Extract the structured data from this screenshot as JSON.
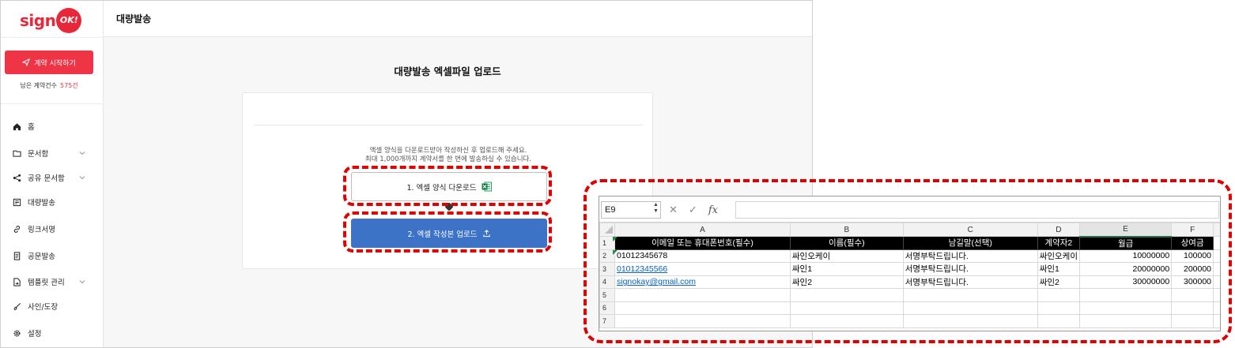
{
  "logo": {
    "text": "sign",
    "badge": "OK!"
  },
  "sidebar": {
    "start_button": "계약 시작하기",
    "remain_label": "남은 계약건수",
    "remain_count": "575건",
    "items": [
      {
        "label": "홈",
        "icon": "home-icon",
        "chevron": false
      },
      {
        "label": "문서함",
        "icon": "folder-icon",
        "chevron": true
      },
      {
        "label": "공유 문서함",
        "icon": "share-icon",
        "chevron": true
      },
      {
        "label": "대량발송",
        "icon": "bulk-send-icon",
        "chevron": false
      },
      {
        "label": "링크서명",
        "icon": "link-icon",
        "chevron": false
      },
      {
        "label": "공문발송",
        "icon": "document-icon",
        "chevron": false
      },
      {
        "label": "템플릿 관리",
        "icon": "template-icon",
        "chevron": true
      },
      {
        "label": "사인/도장",
        "icon": "brush-icon",
        "chevron": false
      },
      {
        "label": "설정",
        "icon": "gear-icon",
        "chevron": false
      }
    ]
  },
  "header": {
    "title": "대량발송"
  },
  "main": {
    "title": "대량발송 엑셀파일 업로드",
    "help_line1": "엑셀 양식을 다운로드받아 작성하신 후 업로드해 주세요.",
    "help_line2": "최대 1,000개까지 계약서를 한 번에 발송하실 수 있습니다.",
    "download_button": "1. 엑셀 양식 다운로드",
    "upload_button": "2. 엑셀 작성본 업로드"
  },
  "excel": {
    "name_box": "E9",
    "fx": "fx",
    "columns": [
      "A",
      "B",
      "C",
      "D",
      "E",
      "F"
    ],
    "selected_column": "E",
    "row_numbers": [
      "1",
      "2",
      "3",
      "4",
      "5",
      "6",
      "7"
    ],
    "header_row": [
      "이메일 또는 휴대폰번호(필수)",
      "이름(필수)",
      "남길말(선택)",
      "계약자2",
      "월급",
      "상여금"
    ],
    "rows": [
      [
        "01012345678",
        "싸인오케이",
        "서명부탁드립니다.",
        "싸인오케이",
        "10000000",
        "100000"
      ],
      [
        "01012345566",
        "싸인1",
        "서명부탁드립니다.",
        "싸인1",
        "20000000",
        "200000"
      ],
      [
        "signokay@gmail.com",
        "싸인2",
        "서명부탁드립니다.",
        "싸인2",
        "30000000",
        "300000"
      ]
    ]
  },
  "colors": {
    "accent": "#ef3545",
    "primary_button": "#3d73c6",
    "highlight": "#e00000"
  }
}
